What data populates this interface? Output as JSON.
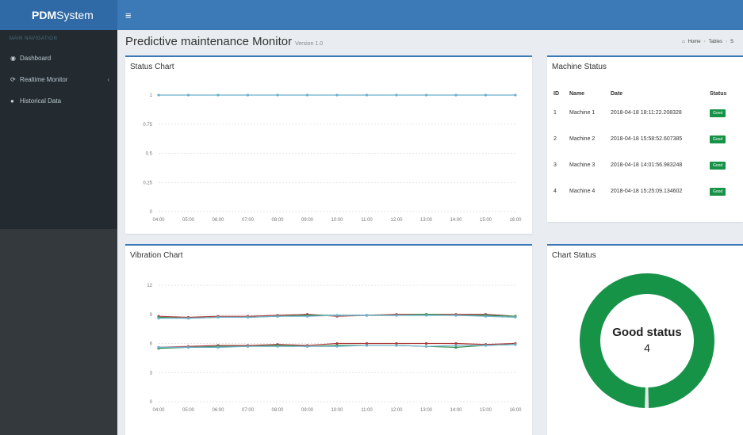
{
  "brand": {
    "bold": "PDM",
    "rest": "System"
  },
  "sidebar": {
    "header": "MAIN NAVIGATION",
    "items": [
      {
        "label": "Dashboard",
        "icon": "dashboard-icon"
      },
      {
        "label": "Realtime Monitor",
        "icon": "refresh-icon",
        "chevron": "‹"
      },
      {
        "label": "Historical Data",
        "icon": "circle-icon"
      }
    ]
  },
  "page": {
    "title": "Predictive maintenance Monitor",
    "version": "Version 1.0"
  },
  "breadcrumb": {
    "home": "Home",
    "tables": "Tables",
    "extra": "S"
  },
  "status_chart": {
    "title": "Status Chart"
  },
  "vibration_chart": {
    "title": "Vibration Chart"
  },
  "machine_status": {
    "title": "Machine Status",
    "columns": [
      "ID",
      "Name",
      "Date",
      "Status"
    ],
    "rows": [
      {
        "id": "1",
        "name": "Machine 1",
        "date": "2018-04-18 18:11:22.208328",
        "status": "Good"
      },
      {
        "id": "2",
        "name": "Machine 2",
        "date": "2018-04-18 15:58:52.607385",
        "status": "Good"
      },
      {
        "id": "3",
        "name": "Machine 3",
        "date": "2018-04-18 14:01:56.983248",
        "status": "Good"
      },
      {
        "id": "4",
        "name": "Machine 4",
        "date": "2018-04-18 15:25:09.134602",
        "status": "Good"
      }
    ]
  },
  "chart_status": {
    "title": "Chart Status",
    "label": "Good status",
    "count": "4",
    "value": 0.99
  },
  "colors": {
    "topbar": "#3c79b7",
    "sidebar": "#232b31",
    "good": "#179348"
  },
  "chart_data": [
    {
      "type": "line",
      "name": "status",
      "x": [
        "04:00",
        "05:00",
        "06:00",
        "07:00",
        "08:00",
        "09:00",
        "10:00",
        "11:00",
        "12:00",
        "13:00",
        "14:00",
        "15:00",
        "16:00"
      ],
      "ylim": [
        0,
        1
      ],
      "yticks": [
        "0",
        "0.25",
        "0.5",
        "0.75",
        "1"
      ],
      "grid": true,
      "series": [
        {
          "color": "#6ab0c9",
          "values": [
            1,
            1,
            1,
            1,
            1,
            1,
            1,
            1,
            1,
            1,
            1,
            1,
            1
          ]
        }
      ]
    },
    {
      "type": "line",
      "name": "vibration",
      "x": [
        "04:00",
        "05:00",
        "06:00",
        "07:00",
        "08:00",
        "09:00",
        "10:00",
        "11:00",
        "12:00",
        "13:00",
        "14:00",
        "15:00",
        "16:00"
      ],
      "ylim": [
        0,
        12
      ],
      "yticks": [
        "0",
        "3",
        "6",
        "9",
        "12"
      ],
      "grid": true,
      "series": [
        {
          "color": "#b03a3a",
          "values": [
            8.8,
            8.7,
            8.8,
            8.8,
            8.9,
            9,
            8.8,
            8.9,
            9,
            9,
            9,
            9,
            8.8
          ]
        },
        {
          "color": "#2f8f4f",
          "values": [
            8.7,
            8.6,
            8.7,
            8.7,
            8.8,
            8.9,
            8.9,
            8.9,
            8.9,
            9,
            8.9,
            8.9,
            8.8
          ]
        },
        {
          "color": "#6ab0c9",
          "values": [
            8.6,
            8.6,
            8.7,
            8.7,
            8.8,
            8.8,
            8.9,
            8.9,
            8.9,
            8.9,
            8.9,
            8.8,
            8.7
          ]
        },
        {
          "color": "#b03a3a",
          "values": [
            5.6,
            5.7,
            5.8,
            5.8,
            5.9,
            5.8,
            6,
            6,
            6,
            6,
            6,
            5.9,
            6
          ]
        },
        {
          "color": "#2f8f4f",
          "values": [
            5.5,
            5.6,
            5.7,
            5.7,
            5.8,
            5.7,
            5.8,
            5.8,
            5.8,
            5.7,
            5.6,
            5.8,
            5.9
          ]
        },
        {
          "color": "#6ab0c9",
          "values": [
            5.6,
            5.6,
            5.6,
            5.7,
            5.7,
            5.7,
            5.7,
            5.8,
            5.8,
            5.7,
            5.8,
            5.8,
            5.9
          ]
        }
      ]
    }
  ]
}
